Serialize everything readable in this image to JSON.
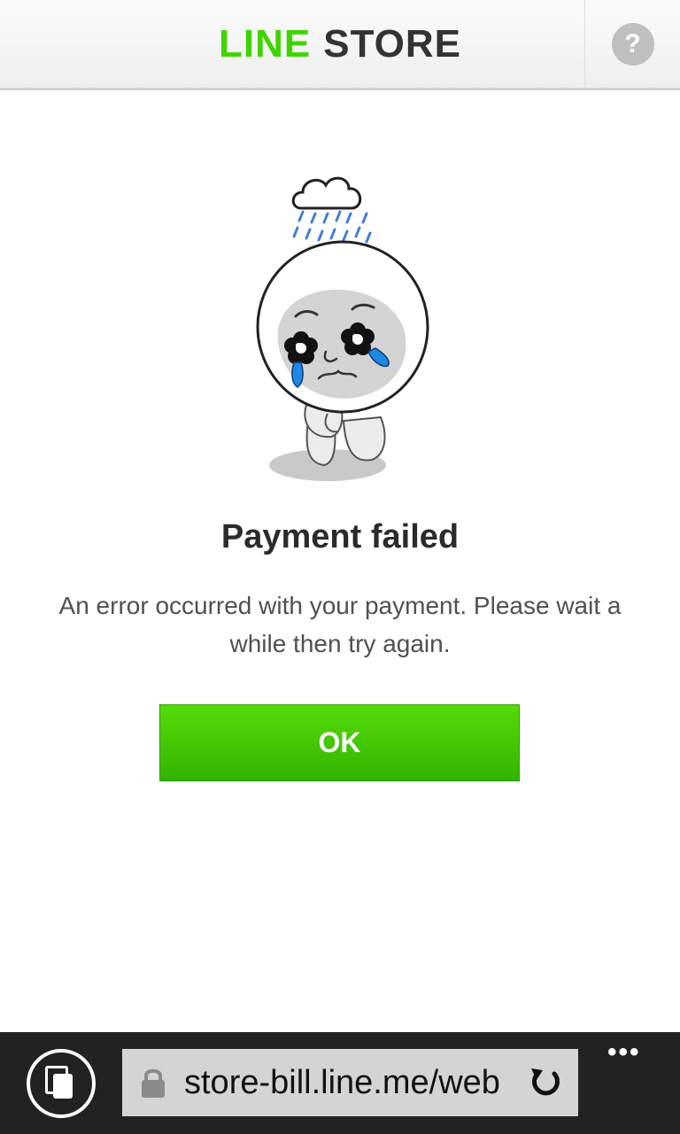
{
  "header": {
    "brand_line": "LINE",
    "brand_store": "STORE",
    "help_icon": "?"
  },
  "illustration": {
    "icon": "crying-character-rain-cloud-icon"
  },
  "dialog": {
    "title": "Payment failed",
    "message": "An error occurred with your payment. Please wait a while then try again.",
    "ok_label": "OK"
  },
  "browser": {
    "url": "store-bill.line.me/web",
    "more_label": "•••",
    "tabs_icon": "tabs-icon",
    "lock_icon": "lock-icon",
    "refresh_icon": "refresh-icon"
  },
  "colors": {
    "brand_green": "#3fd400",
    "button_green": "#44c700",
    "tear_blue": "#1e88e5",
    "rain_blue": "#3f7fd9"
  }
}
